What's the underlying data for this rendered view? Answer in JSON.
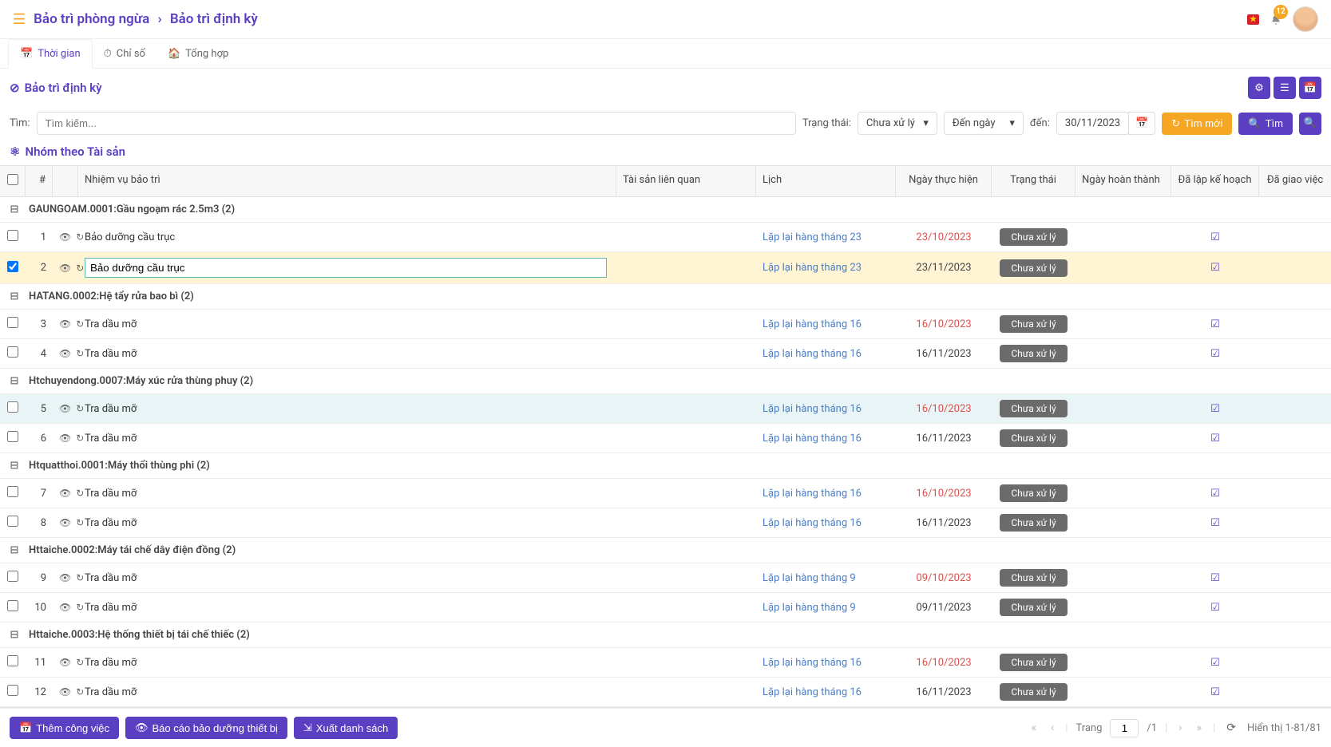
{
  "header": {
    "breadcrumb_parent": "Bảo trì phòng ngừa",
    "breadcrumb_current": "Bảo trì định kỳ",
    "notification_count": "12",
    "flag": "★"
  },
  "tabs": [
    {
      "label": "Thời gian",
      "icon": "calendar"
    },
    {
      "label": "Chỉ số",
      "icon": "gauge"
    },
    {
      "label": "Tổng hợp",
      "icon": "home"
    }
  ],
  "section": {
    "title": "Bảo trì định kỳ"
  },
  "filters": {
    "search_label": "Tìm:",
    "search_placeholder": "Tìm kiếm...",
    "status_label": "Trạng thái:",
    "status_value": "Chưa xử lý",
    "range_value": "Đến ngày",
    "to_label": "đến:",
    "to_date": "30/11/2023",
    "new_btn": "Tìm mới",
    "find_btn": "Tìm"
  },
  "group_title": "Nhóm theo Tài sản",
  "columns": {
    "num": "#",
    "task": "Nhiệm vụ bảo trì",
    "asset": "Tài sản liên quan",
    "sched": "Lịch",
    "date": "Ngày thực hiện",
    "status": "Trạng thái",
    "complete": "Ngày hoàn thành",
    "plan": "Đã lập kế hoạch",
    "assign": "Đã giao việc"
  },
  "groups": [
    {
      "label": "GAUNGOAM.0001:Gầu ngoạm rác 2.5m3 (2)",
      "rows": [
        {
          "n": "1",
          "task": "Bảo dưỡng cầu trục",
          "sched": "Lặp lại hàng tháng 23",
          "date": "23/10/2023",
          "red": true,
          "status": "Chưa xử lý",
          "plan": true
        },
        {
          "n": "2",
          "task": "Bảo dưỡng cầu trục",
          "sched": "Lặp lại hàng tháng 23",
          "date": "23/11/2023",
          "red": false,
          "status": "Chưa xử lý",
          "plan": true,
          "selected": true,
          "checked": true,
          "edit": true
        }
      ]
    },
    {
      "label": "HATANG.0002:Hệ tẩy rửa bao bì (2)",
      "rows": [
        {
          "n": "3",
          "task": "Tra dầu mỡ",
          "sched": "Lặp lại hàng tháng 16",
          "date": "16/10/2023",
          "red": true,
          "status": "Chưa xử lý",
          "plan": true
        },
        {
          "n": "4",
          "task": "Tra dầu mỡ",
          "sched": "Lặp lại hàng tháng 16",
          "date": "16/11/2023",
          "red": false,
          "status": "Chưa xử lý",
          "plan": true
        }
      ]
    },
    {
      "label": "Htchuyendong.0007:Máy xúc rửa thùng phuy (2)",
      "rows": [
        {
          "n": "5",
          "task": "Tra dầu mỡ",
          "sched": "Lặp lại hàng tháng 16",
          "date": "16/10/2023",
          "red": true,
          "status": "Chưa xử lý",
          "plan": true,
          "highlight": true
        },
        {
          "n": "6",
          "task": "Tra dầu mỡ",
          "sched": "Lặp lại hàng tháng 16",
          "date": "16/11/2023",
          "red": false,
          "status": "Chưa xử lý",
          "plan": true
        }
      ]
    },
    {
      "label": "Htquatthoi.0001:Máy thổi thùng phi (2)",
      "rows": [
        {
          "n": "7",
          "task": "Tra dầu mỡ",
          "sched": "Lặp lại hàng tháng 16",
          "date": "16/10/2023",
          "red": true,
          "status": "Chưa xử lý",
          "plan": true
        },
        {
          "n": "8",
          "task": "Tra dầu mỡ",
          "sched": "Lặp lại hàng tháng 16",
          "date": "16/11/2023",
          "red": false,
          "status": "Chưa xử lý",
          "plan": true
        }
      ]
    },
    {
      "label": "Httaiche.0002:Máy tái chế dây điện đồng (2)",
      "rows": [
        {
          "n": "9",
          "task": "Tra dầu mỡ",
          "sched": "Lặp lại hàng tháng 9",
          "date": "09/10/2023",
          "red": true,
          "status": "Chưa xử lý",
          "plan": true
        },
        {
          "n": "10",
          "task": "Tra dầu mỡ",
          "sched": "Lặp lại hàng tháng 9",
          "date": "09/11/2023",
          "red": false,
          "status": "Chưa xử lý",
          "plan": true
        }
      ]
    },
    {
      "label": "Httaiche.0003:Hệ thống thiết bị tái chế thiếc (2)",
      "rows": [
        {
          "n": "11",
          "task": "Tra dầu mỡ",
          "sched": "Lặp lại hàng tháng 16",
          "date": "16/10/2023",
          "red": true,
          "status": "Chưa xử lý",
          "plan": true
        },
        {
          "n": "12",
          "task": "Tra dầu mỡ",
          "sched": "Lặp lại hàng tháng 16",
          "date": "16/11/2023",
          "red": false,
          "status": "Chưa xử lý",
          "plan": true
        }
      ]
    }
  ],
  "footer": {
    "add_job": "Thêm công việc",
    "report": "Báo cáo bảo dưỡng thiết bị",
    "export": "Xuất danh sách",
    "page_label": "Trang",
    "page": "1",
    "total_pages": "/1",
    "display": "Hiển thị 1-81/81"
  }
}
